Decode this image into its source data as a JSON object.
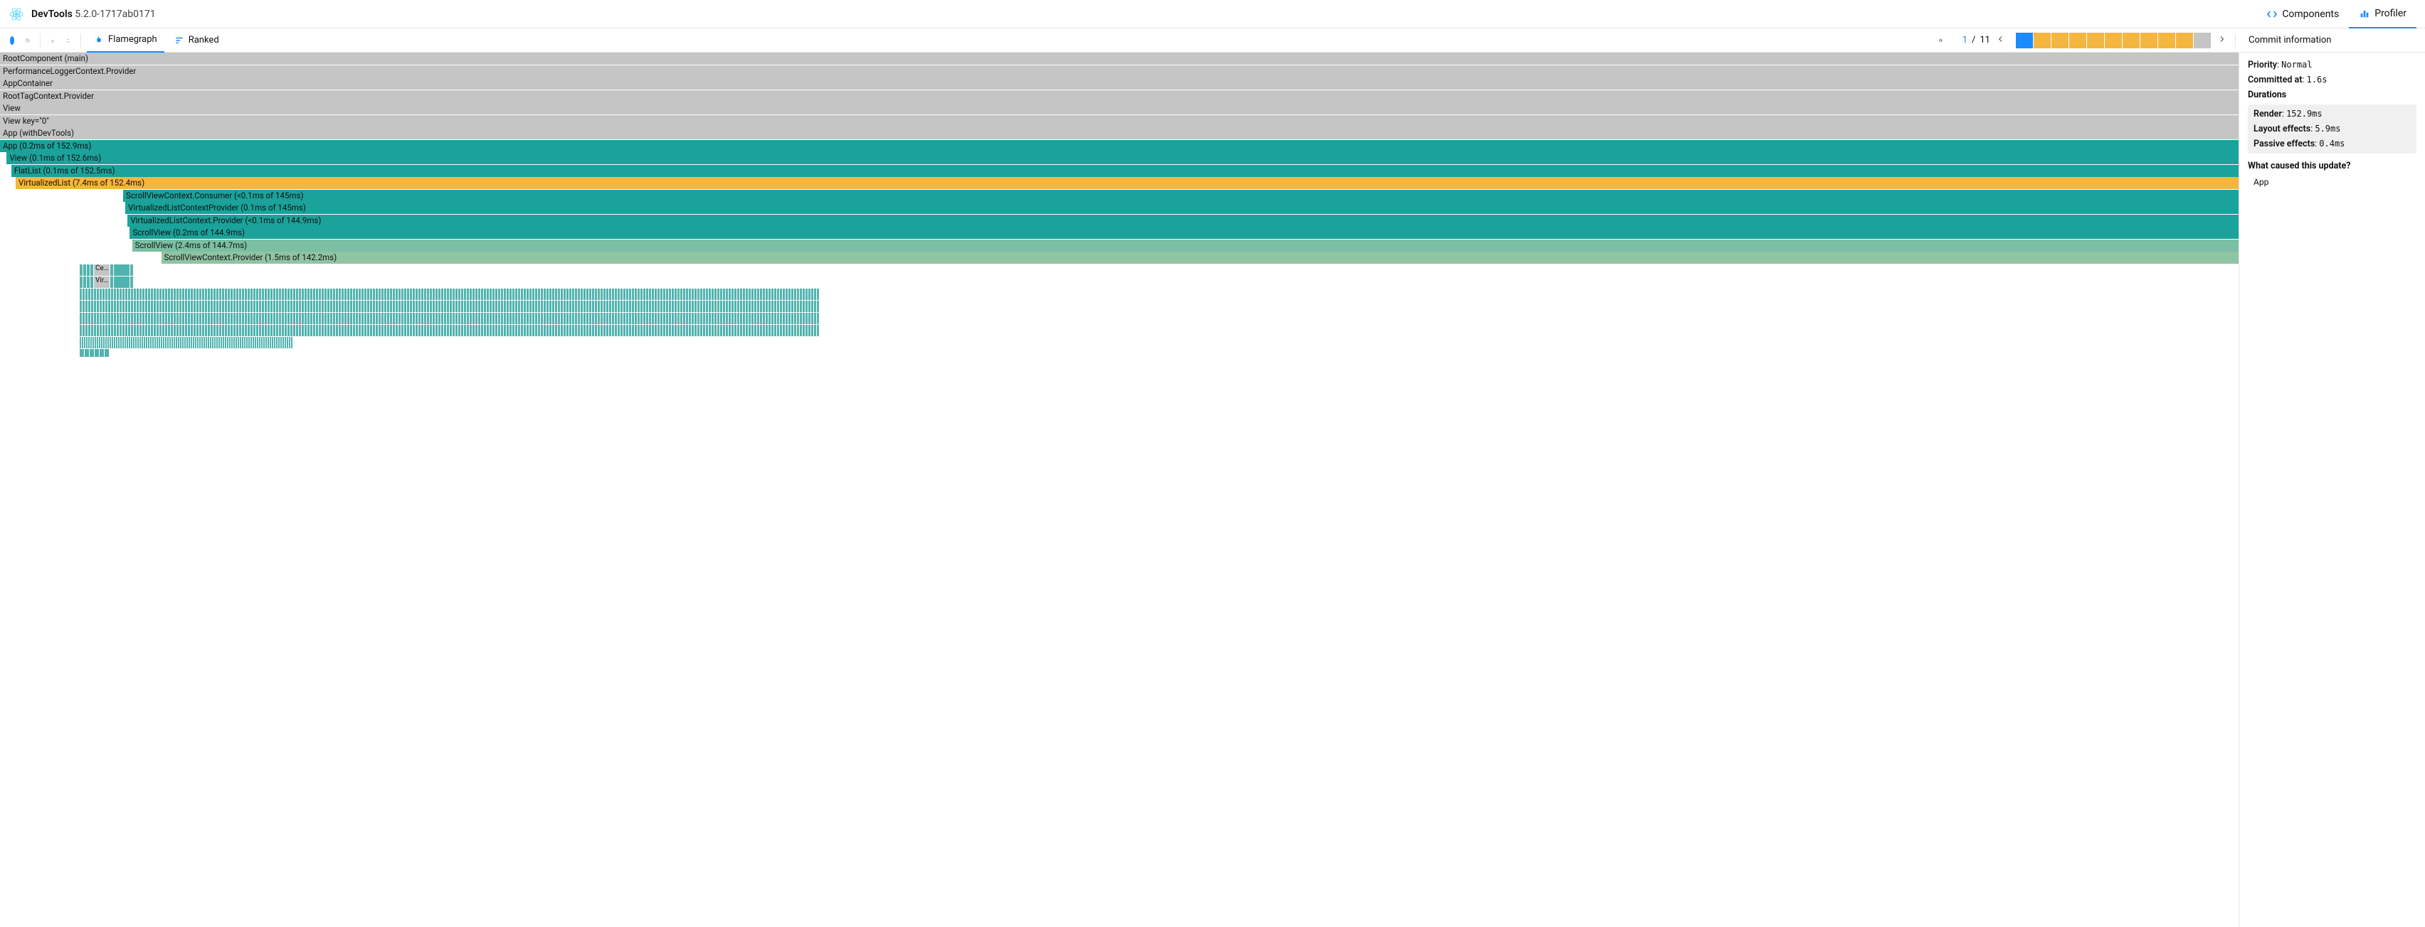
{
  "header": {
    "title": "DevTools",
    "version": "5.2.0-1717ab0171",
    "tabs": {
      "components": "Components",
      "profiler": "Profiler"
    }
  },
  "toolbar": {
    "views": {
      "flamegraph": "Flamegraph",
      "ranked": "Ranked"
    },
    "commit": {
      "current": "1",
      "sep": "/",
      "total": "11"
    },
    "commit_bars": [
      {
        "selected": true,
        "cls": "selected"
      },
      {
        "cls": "y"
      },
      {
        "cls": "y"
      },
      {
        "cls": "y"
      },
      {
        "cls": "y"
      },
      {
        "cls": "y"
      },
      {
        "cls": "y"
      },
      {
        "cls": "y"
      },
      {
        "cls": "y"
      },
      {
        "cls": "y"
      },
      {
        "cls": "g"
      }
    ]
  },
  "flame": [
    {
      "label": "RootComponent (main)",
      "cls": "gray",
      "left": 0,
      "width": 100
    },
    {
      "label": "PerformanceLoggerContext.Provider",
      "cls": "gray",
      "left": 0,
      "width": 100
    },
    {
      "label": "AppContainer",
      "cls": "gray",
      "left": 0,
      "width": 100
    },
    {
      "label": "RootTagContext.Provider",
      "cls": "gray",
      "left": 0,
      "width": 100
    },
    {
      "label": "View",
      "cls": "gray",
      "left": 0,
      "width": 100
    },
    {
      "label": "View key=\"0\"",
      "cls": "gray",
      "left": 0,
      "width": 100
    },
    {
      "label": "App (withDevTools)",
      "cls": "gray",
      "left": 0,
      "width": 100
    },
    {
      "label": "App (0.2ms of 152.9ms)",
      "cls": "teal",
      "left": 0,
      "width": 100
    },
    {
      "label": "View (0.1ms of 152.6ms)",
      "cls": "teal",
      "left": 0.3,
      "width": 99.7
    },
    {
      "label": "FlatList (0.1ms of 152.5ms)",
      "cls": "teal",
      "left": 0.5,
      "width": 99.5
    },
    {
      "label": "VirtualizedList (7.4ms of 152.4ms)",
      "cls": "yellow",
      "left": 0.7,
      "width": 99.3
    },
    {
      "label": "ScrollViewContext.Consumer (<0.1ms of 145ms)",
      "cls": "teal",
      "left": 5.5,
      "width": 94.5
    },
    {
      "label": "VirtualizedListContextProvider (0.1ms of 145ms)",
      "cls": "teal",
      "left": 5.6,
      "width": 94.4
    },
    {
      "label": "VirtualizedListContext.Provider (<0.1ms of 144.9ms)",
      "cls": "teal",
      "left": 5.7,
      "width": 94.3
    },
    {
      "label": "ScrollView (0.2ms of 144.9ms)",
      "cls": "teal",
      "left": 5.8,
      "width": 94.2
    },
    {
      "label": "ScrollView (2.4ms of 144.7ms)",
      "cls": "tealL",
      "left": 5.9,
      "width": 94.1
    },
    {
      "label": "ScrollViewContext.Provider (1.5ms of 142.2ms)",
      "cls": "tealM",
      "left": 7.2,
      "width": 92.8
    }
  ],
  "tiny_labels": {
    "cell": "Ce…",
    "vir": "Vir…"
  },
  "side": {
    "title": "Commit information",
    "priority_label": "Priority",
    "priority_value": "Normal",
    "committed_label": "Committed at",
    "committed_value": "1.6s",
    "durations_label": "Durations",
    "render_label": "Render",
    "render_value": "152.9ms",
    "layout_label": "Layout effects",
    "layout_value": "5.9ms",
    "passive_label": "Passive effects",
    "passive_value": "0.4ms",
    "cause_label": "What caused this update?",
    "cause_item": "App"
  }
}
